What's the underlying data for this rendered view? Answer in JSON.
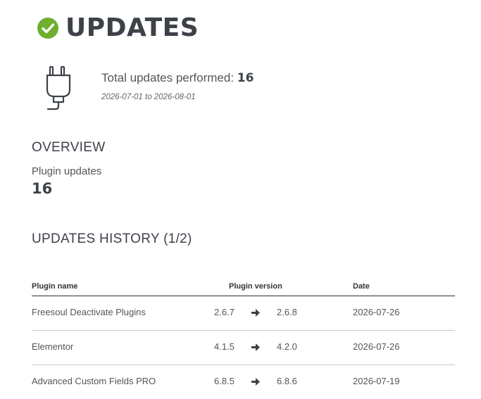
{
  "header": {
    "title": "UPDATES",
    "icon": "check-circle-icon",
    "accent_color": "#6fae2e"
  },
  "summary": {
    "icon": "plug-icon",
    "total_label": "Total updates performed:",
    "total_value": "16",
    "date_range": "2026-07-01 to 2026-08-01"
  },
  "overview": {
    "heading": "OVERVIEW",
    "plugin_updates_label": "Plugin updates",
    "plugin_updates_value": "16"
  },
  "history": {
    "heading": "UPDATES HISTORY (1/2)",
    "columns": {
      "name": "Plugin name",
      "version": "Plugin version",
      "date": "Date"
    },
    "rows": [
      {
        "name": "Freesoul Deactivate Plugins",
        "from": "2.6.7",
        "to": "2.6.8",
        "date": "2026-07-26"
      },
      {
        "name": "Elementor",
        "from": "4.1.5",
        "to": "4.2.0",
        "date": "2026-07-26"
      },
      {
        "name": "Advanced Custom Fields PRO",
        "from": "6.8.5",
        "to": "6.8.6",
        "date": "2026-07-19"
      }
    ]
  }
}
